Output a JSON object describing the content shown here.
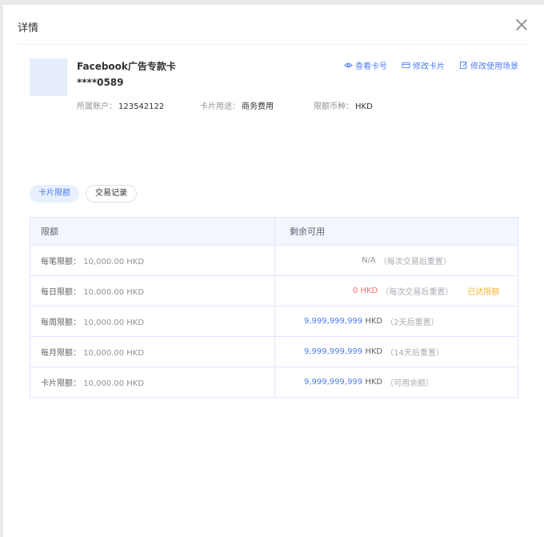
{
  "header": {
    "title": "详情"
  },
  "card": {
    "name": "Facebook广告专款卡",
    "number": "****0589",
    "account_label": "所属账户：",
    "account_value": "123542122",
    "purpose_label": "卡片用途：",
    "purpose_value": "商务费用",
    "currency_label": "限额币种：",
    "currency_value": "HKD"
  },
  "actions": {
    "view_card_no": "查看卡号",
    "edit_card": "修改卡片",
    "edit_scene": "修改使用场景"
  },
  "tabs": [
    {
      "label": "卡片限额",
      "active": true
    },
    {
      "label": "交易记录",
      "active": false
    }
  ],
  "table": {
    "headers": [
      "限额",
      "剩余可用"
    ],
    "rows": [
      {
        "label": "每笔限额：",
        "limit": "10,000.00 HKD",
        "remaining_amount": "N/A",
        "remaining_unit": "",
        "note": "（每次交易后重置）",
        "badge": "",
        "style": "center-gray"
      },
      {
        "label": "每日限额：",
        "limit": "10,000.00 HKD",
        "remaining_amount": "0 HKD",
        "remaining_unit": "",
        "note": "（每次交易后重置）",
        "badge": "已达限额",
        "style": "red"
      },
      {
        "label": "每周限额：",
        "limit": "10,000.00 HKD",
        "remaining_amount": "9,999,999,999",
        "remaining_unit": "HKD",
        "note": "（2天后重置）",
        "badge": "",
        "style": "blue"
      },
      {
        "label": "每月限额：",
        "limit": "10,000.00 HKD",
        "remaining_amount": "9,999,999,999",
        "remaining_unit": "HKD",
        "note": "（14天后重置）",
        "badge": "",
        "style": "blue"
      },
      {
        "label": "卡片限额：",
        "limit": "10,000.00 HKD",
        "remaining_amount": "9,999,999,999",
        "remaining_unit": "HKD",
        "note": "（可用余额）",
        "badge": "",
        "style": "blue"
      }
    ]
  },
  "colors": {
    "accent": "#4f7df0",
    "danger": "#f56c6c",
    "warning": "#f2b42f"
  }
}
